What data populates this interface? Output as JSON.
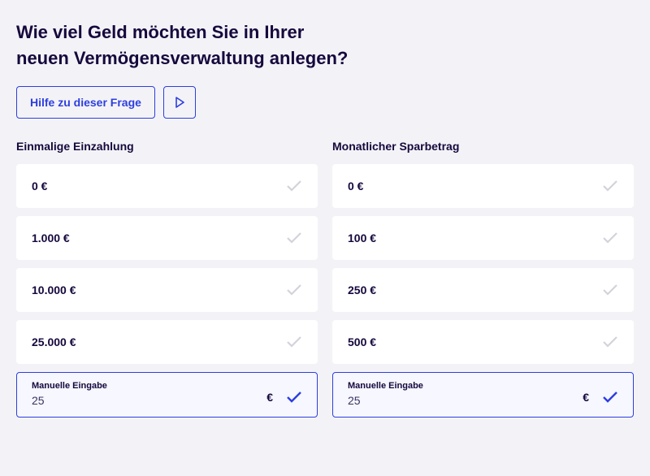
{
  "heading_line1": "Wie viel Geld möchten Sie in Ihrer",
  "heading_line2": "neuen Vermögensverwaltung anlegen?",
  "help_button": "Hilfe zu dieser Frage",
  "columns": {
    "left": {
      "title": "Einmalige Einzahlung",
      "options": [
        "0 €",
        "1.000 €",
        "10.000 €",
        "25.000 €"
      ],
      "manual_label": "Manuelle Eingabe",
      "manual_value": "25",
      "currency": "€"
    },
    "right": {
      "title": "Monatlicher Sparbetrag",
      "options": [
        "0 €",
        "100 €",
        "250 €",
        "500 €"
      ],
      "manual_label": "Manuelle Eingabe",
      "manual_value": "25",
      "currency": "€"
    }
  }
}
